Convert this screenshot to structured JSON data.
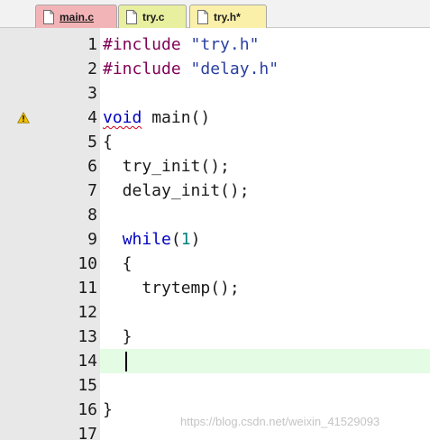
{
  "tabs": [
    {
      "label": "main.c",
      "active": true,
      "color": "#f3b4b7",
      "icon": "c-file-icon"
    },
    {
      "label": "try.c",
      "active": false,
      "color": "#e8ef9e",
      "icon": "c-file-icon"
    },
    {
      "label": "try.h*",
      "active": false,
      "color": "#fbf0a9",
      "icon": "header-file-icon"
    }
  ],
  "editor": {
    "current_line": 14,
    "current_line_color": "#e4fbe4",
    "warning_line": 4,
    "lines": [
      {
        "num": "1",
        "tokens": [
          {
            "t": "#include ",
            "c": "directive"
          },
          {
            "t": "\"try.h\"",
            "c": "string"
          }
        ]
      },
      {
        "num": "2",
        "tokens": [
          {
            "t": "#include ",
            "c": "directive"
          },
          {
            "t": "\"delay.h\"",
            "c": "string"
          }
        ]
      },
      {
        "num": "3",
        "tokens": []
      },
      {
        "num": "4",
        "tokens": [
          {
            "t": "void",
            "c": "keyword squiggle"
          },
          {
            "t": " main()",
            "c": ""
          }
        ]
      },
      {
        "num": "5",
        "tokens": [
          {
            "t": "{",
            "c": ""
          }
        ]
      },
      {
        "num": "6",
        "tokens": [
          {
            "t": "  try_init();",
            "c": ""
          }
        ]
      },
      {
        "num": "7",
        "tokens": [
          {
            "t": "  delay_init();",
            "c": ""
          }
        ]
      },
      {
        "num": "8",
        "tokens": []
      },
      {
        "num": "9",
        "tokens": [
          {
            "t": "  ",
            "c": ""
          },
          {
            "t": "while",
            "c": "keyword"
          },
          {
            "t": "(",
            "c": ""
          },
          {
            "t": "1",
            "c": "number"
          },
          {
            "t": ")",
            "c": ""
          }
        ]
      },
      {
        "num": "10",
        "tokens": [
          {
            "t": "  {",
            "c": ""
          }
        ]
      },
      {
        "num": "11",
        "tokens": [
          {
            "t": "    trytemp();",
            "c": ""
          }
        ]
      },
      {
        "num": "12",
        "tokens": []
      },
      {
        "num": "13",
        "tokens": [
          {
            "t": "  }",
            "c": ""
          }
        ]
      },
      {
        "num": "14",
        "tokens": []
      },
      {
        "num": "15",
        "tokens": []
      },
      {
        "num": "16",
        "tokens": [
          {
            "t": "}",
            "c": ""
          }
        ]
      },
      {
        "num": "17",
        "tokens": []
      }
    ]
  },
  "watermark": "https://blog.csdn.net/weixin_41529093"
}
